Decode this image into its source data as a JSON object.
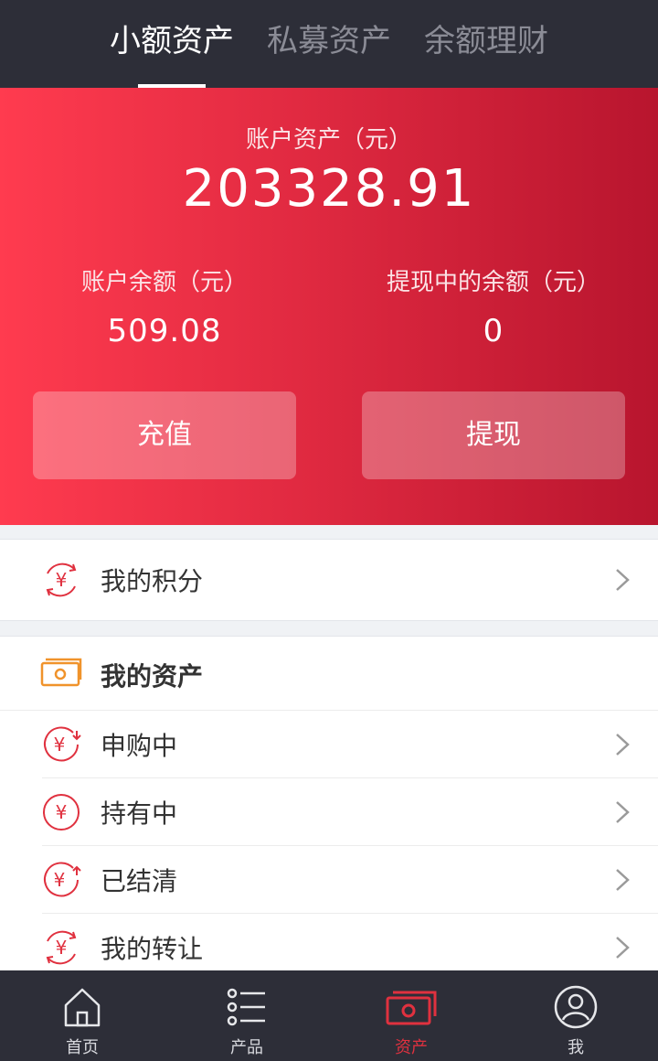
{
  "tabs": [
    {
      "label": "小额资产",
      "active": true
    },
    {
      "label": "私募资产",
      "active": false
    },
    {
      "label": "余额理财",
      "active": false
    }
  ],
  "hero": {
    "total_label": "账户资产（元）",
    "total_value": "203328.91",
    "balance_label": "账户余额（元）",
    "balance_value": "509.08",
    "withdrawing_label": "提现中的余额（元）",
    "withdrawing_value": "0",
    "recharge_button": "充值",
    "withdraw_button": "提现"
  },
  "points": {
    "label": "我的积分",
    "icon": "yuan-cycle-icon"
  },
  "assets": {
    "header": "我的资产",
    "header_icon": "cash-icon",
    "items": [
      {
        "label": "申购中",
        "icon": "yuan-in-icon"
      },
      {
        "label": "持有中",
        "icon": "yuan-icon"
      },
      {
        "label": "已结清",
        "icon": "yuan-out-icon"
      },
      {
        "label": "我的转让",
        "icon": "yuan-transfer-icon"
      }
    ]
  },
  "bottom_nav": [
    {
      "label": "首页",
      "icon": "home-icon",
      "active": false
    },
    {
      "label": "产品",
      "icon": "list-icon",
      "active": false
    },
    {
      "label": "资产",
      "icon": "cash-icon",
      "active": true
    },
    {
      "label": "我",
      "icon": "user-icon",
      "active": false
    }
  ],
  "colors": {
    "accent": "#e0313f",
    "dark_bar": "#2d2e38",
    "orange_icon": "#f0932b"
  }
}
